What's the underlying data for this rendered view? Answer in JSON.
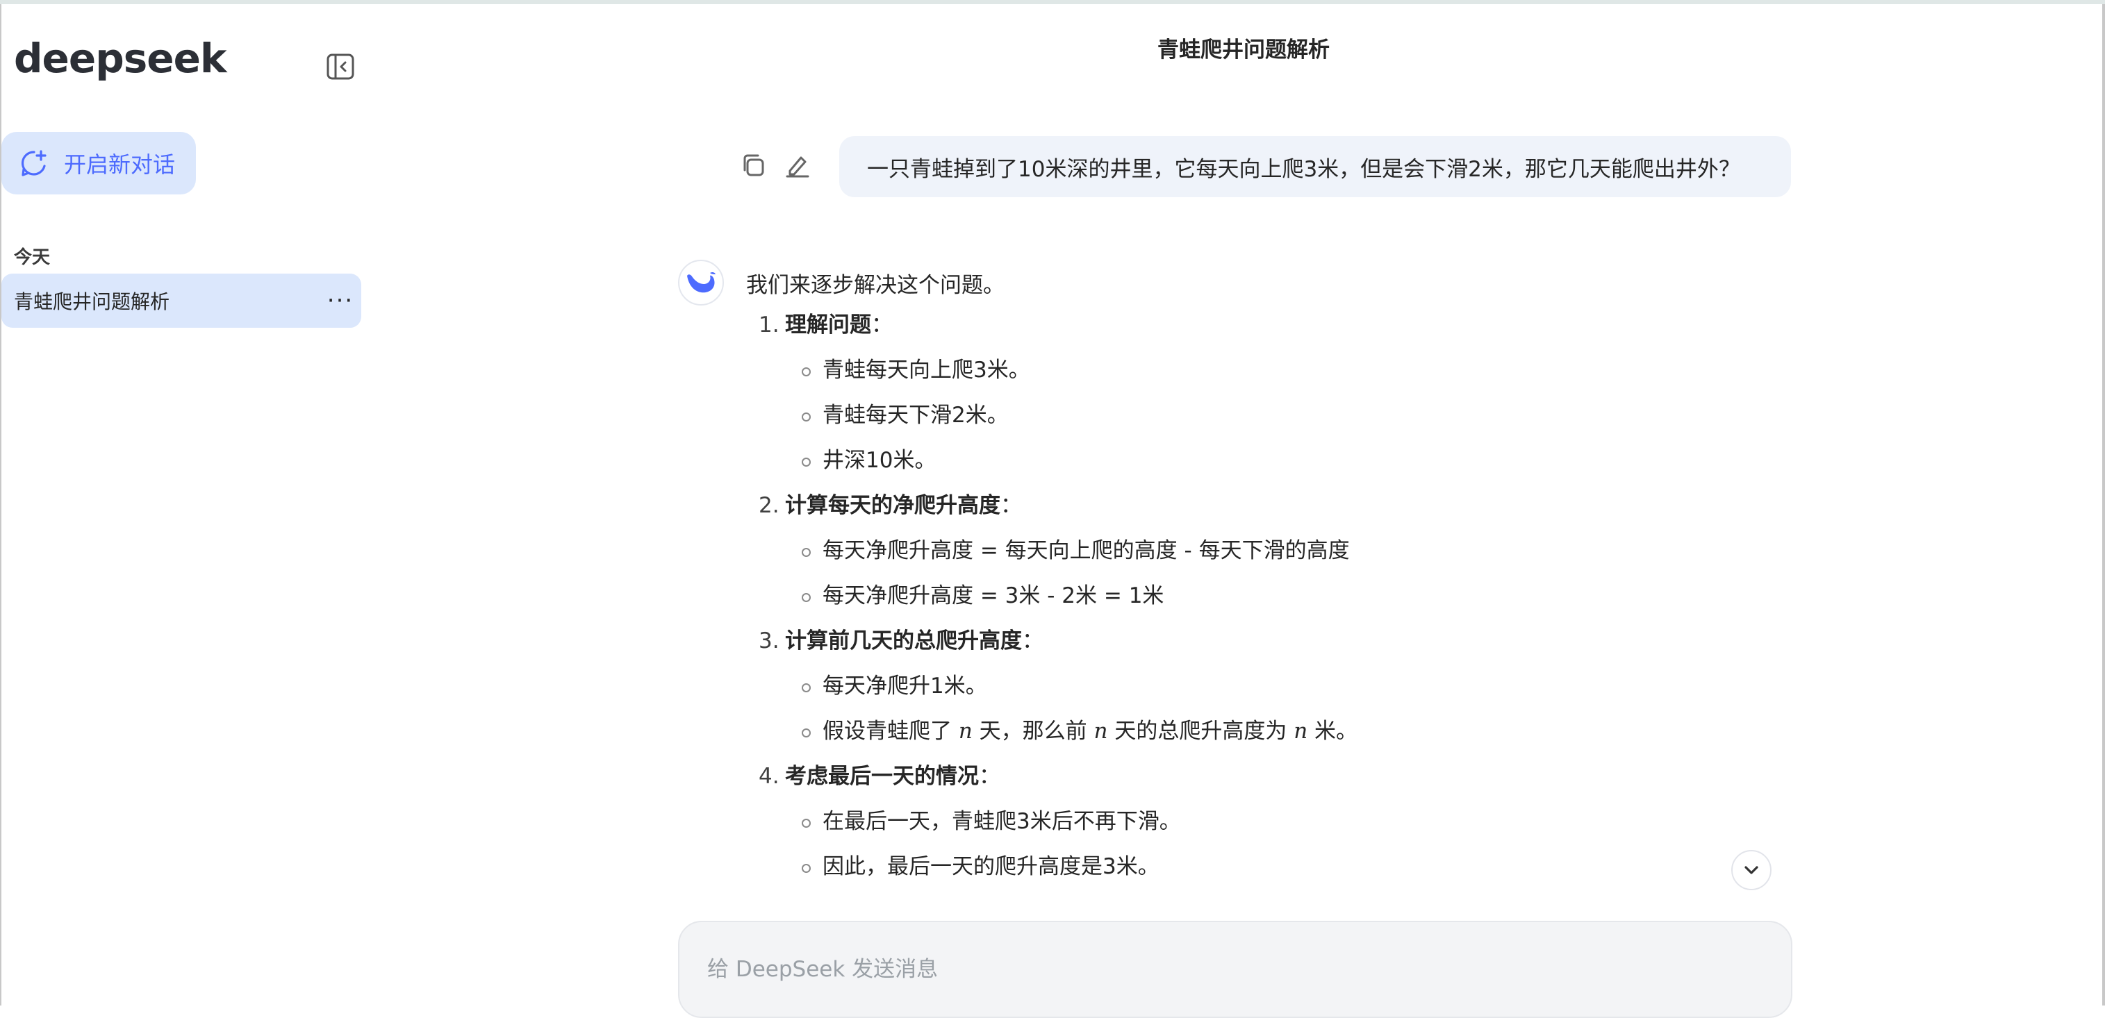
{
  "app": {
    "logo": "deepseek"
  },
  "sidebar": {
    "new_chat_label": "开启新对话",
    "group_title": "今天",
    "history": [
      {
        "label": "青蛙爬井问题解析",
        "more": "···"
      }
    ]
  },
  "header": {
    "title": "青蛙爬井问题解析"
  },
  "user_message": "一只青蛙掉到了10米深的井里，它每天向上爬3米，但是会下滑2米，那它几天能爬出井外？",
  "answer": {
    "intro": "我们来逐步解决这个问题。",
    "steps": [
      {
        "num": "1.",
        "title": "理解问题",
        "colon": "：",
        "items": [
          "青蛙每天向上爬3米。",
          "青蛙每天下滑2米。",
          "井深10米。"
        ]
      },
      {
        "num": "2.",
        "title": "计算每天的净爬升高度",
        "colon": "：",
        "items": [
          "每天净爬升高度 = 每天向上爬的高度 - 每天下滑的高度",
          "每天净爬升高度 = 3米 - 2米 = 1米"
        ]
      },
      {
        "num": "3.",
        "title": "计算前几天的总爬升高度",
        "colon": "：",
        "items": [
          "每天净爬升1米。"
        ],
        "math_item": {
          "a": "假设青蛙爬了 ",
          "var1": "n",
          "b": " 天，那么前 ",
          "var2": "n",
          "c": " 天的总爬升高度为 ",
          "var3": "n",
          "d": " 米。"
        }
      },
      {
        "num": "4.",
        "title": "考虑最后一天的情况",
        "colon": "：",
        "items": [
          "在最后一天，青蛙爬3米后不再下滑。",
          "因此，最后一天的爬升高度是3米。"
        ]
      }
    ]
  },
  "input": {
    "placeholder": "给 DeepSeek 发送消息"
  },
  "colors": {
    "accent": "#4d6bfe",
    "selected_bg": "#dbe7fc",
    "bubble_bg": "#eff3fa"
  }
}
